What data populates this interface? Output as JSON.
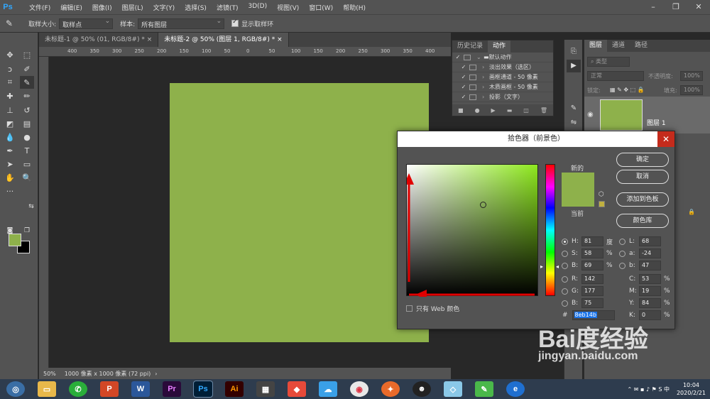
{
  "app": {
    "logo": "Ps",
    "menus": [
      "文件(F)",
      "编辑(E)",
      "图像(I)",
      "图层(L)",
      "文字(Y)",
      "选择(S)",
      "滤镜(T)",
      "3D(D)",
      "视图(V)",
      "窗口(W)",
      "帮助(H)"
    ]
  },
  "options": {
    "sample_size_label": "取样大小:",
    "sample_size_value": "取样点",
    "sample_label": "样本:",
    "sample_value": "所有图层",
    "show_ring_label": "显示取样环",
    "show_ring_checked": true
  },
  "tabs": [
    {
      "label": "未标题-1 @ 50% (01, RGB/8#) *",
      "active": false
    },
    {
      "label": "未标题-2 @ 50% (图层 1, RGB/8#) *",
      "active": true
    }
  ],
  "ruler_labels": [
    "400",
    "350",
    "300",
    "250",
    "200",
    "150",
    "100",
    "50",
    "0",
    "50",
    "100",
    "150",
    "200",
    "250",
    "300",
    "350",
    "400"
  ],
  "canvas_color": "#8eb14b",
  "status": {
    "zoom": "50%",
    "doc_info": "1000 像素 x 1000 像素 (72 ppi)"
  },
  "history_panel": {
    "tabs": [
      "历史记录",
      "动作"
    ],
    "actions": [
      {
        "label": "默认动作",
        "folder": true
      },
      {
        "label": "淡出效果（选区）"
      },
      {
        "label": "画框通道 - 50 像素"
      },
      {
        "label": "木质画框 - 50 像素"
      },
      {
        "label": "投影（文字）"
      }
    ]
  },
  "layers_panel": {
    "tabs": [
      "图层",
      "通道",
      "路径"
    ],
    "kind_label": "类型",
    "blend_mode": "正常",
    "opacity_label": "不透明度:",
    "opacity_value": "100%",
    "lock_label": "锁定:",
    "fill_label": "填充:",
    "fill_value": "100%",
    "layer_name": "图层 1"
  },
  "color_picker": {
    "title": "拾色器（前景色）",
    "close": "✕",
    "new_label": "新的",
    "current_label": "当前",
    "new_color": "#8eb14b",
    "current_color": "#8eb14b",
    "buttons": {
      "ok": "确定",
      "cancel": "取消",
      "add_swatch": "添加到色板",
      "libraries": "颜色库"
    },
    "hsb": [
      {
        "k": "H:",
        "v": "81",
        "u": "度"
      },
      {
        "k": "S:",
        "v": "58",
        "u": "%"
      },
      {
        "k": "B:",
        "v": "69",
        "u": "%"
      }
    ],
    "rgb": [
      {
        "k": "R:",
        "v": "142"
      },
      {
        "k": "G:",
        "v": "177"
      },
      {
        "k": "B:",
        "v": "75"
      }
    ],
    "lab": [
      {
        "k": "L:",
        "v": "68"
      },
      {
        "k": "a:",
        "v": "-24"
      },
      {
        "k": "b:",
        "v": "47"
      }
    ],
    "cmyk": [
      {
        "k": "C:",
        "v": "53",
        "u": "%"
      },
      {
        "k": "M:",
        "v": "19",
        "u": "%"
      },
      {
        "k": "Y:",
        "v": "84",
        "u": "%"
      },
      {
        "k": "K:",
        "v": "0",
        "u": "%"
      }
    ],
    "hex_label": "#",
    "hex_value": "8eb14b",
    "web_only_label": "只有 Web 颜色"
  },
  "taskbar": {
    "time": "10:04",
    "date": "2020/2/21"
  },
  "watermark": {
    "brand": "Bai度经验",
    "url": "jingyan.baidu.com"
  }
}
